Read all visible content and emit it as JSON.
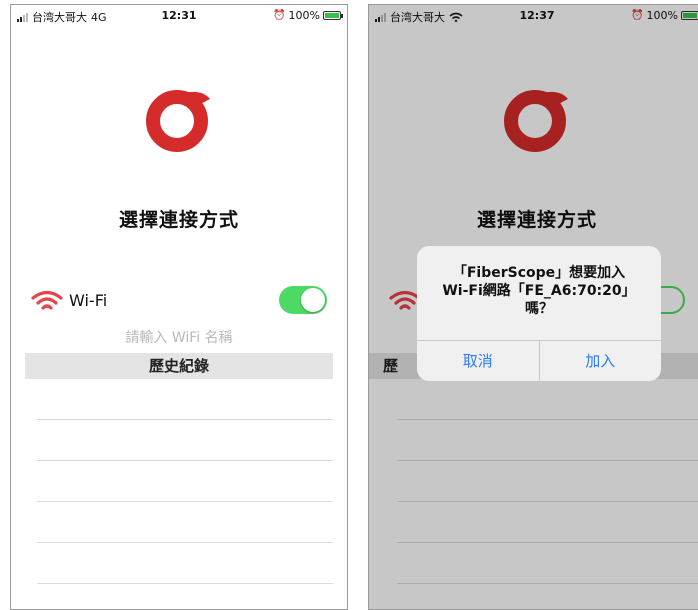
{
  "left_screen": {
    "status": {
      "carrier": "台湾大哥大",
      "network": "4G",
      "time": "12:31",
      "battery": "100%"
    },
    "title": "選擇連接方式",
    "wifi": {
      "label": "Wi-Fi",
      "enabled": true
    },
    "wifi_name_placeholder": "請輸入 WiFi 名稱",
    "history_header": "歷史紀錄",
    "history_rows": 5
  },
  "right_screen": {
    "status": {
      "carrier": "台湾大哥大",
      "time": "12:37",
      "battery": "100%"
    },
    "title": "選擇連接方式",
    "history_header_partial": "歷",
    "alert": {
      "line1": "「FiberScope」想要加入",
      "line2": "Wi-Fi網路「FE_A6:70:20」",
      "line3": "嗎？",
      "cancel": "取消",
      "join": "加入"
    }
  },
  "colors": {
    "brand_red": "#d62b2b",
    "toggle_green": "#4cd964",
    "ios_blue": "#2b7cf6"
  },
  "icons": [
    "signal-icon",
    "wifi-icon",
    "alarm-icon",
    "battery-icon",
    "app-logo"
  ]
}
